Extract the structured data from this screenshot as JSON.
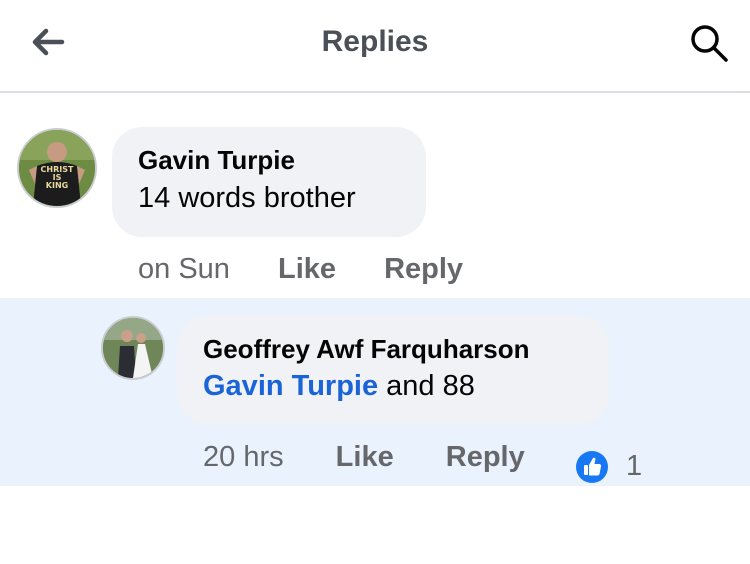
{
  "header": {
    "title": "Replies",
    "back_icon": "arrow-left-icon",
    "search_icon": "search-icon"
  },
  "comment": {
    "author": "Gavin Turpie",
    "text": "14 words brother",
    "avatar_shirt_text": [
      "CHRIST",
      "IS",
      "KING"
    ],
    "time": "on Sun",
    "like_label": "Like",
    "reply_label": "Reply"
  },
  "reply": {
    "author": "Geoffrey Awf Farquharson",
    "mention": "Gavin Turpie",
    "text": " and 88",
    "time": "20 hrs",
    "like_label": "Like",
    "reply_label": "Reply",
    "reaction_icon": "thumbs-up-icon",
    "reaction_count": "1"
  },
  "colors": {
    "accent": "#1877f2",
    "mention": "#1b64d8",
    "bubble": "#f0f2f5",
    "highlight": "#eaf3fd",
    "meta": "#65676b"
  }
}
